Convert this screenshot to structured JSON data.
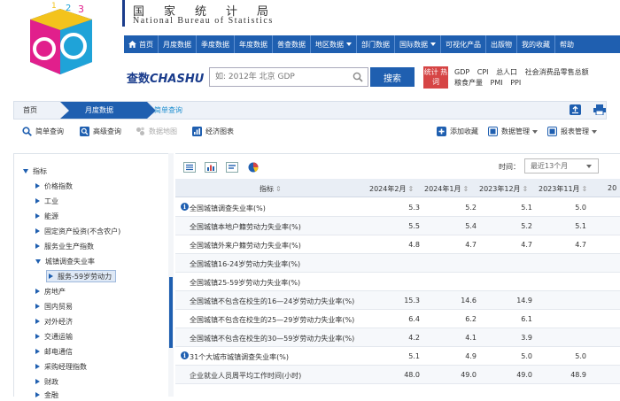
{
  "site": {
    "title_cn": "国家统计局",
    "title_en": "National Bureau of Statistics"
  },
  "nav": {
    "items": [
      {
        "label": "首页",
        "icon": "home-icon"
      },
      {
        "label": "月度数据"
      },
      {
        "label": "季度数据"
      },
      {
        "label": "年度数据"
      },
      {
        "label": "普查数据"
      },
      {
        "label": "地区数据",
        "dropdown": true
      },
      {
        "label": "部门数据"
      },
      {
        "label": "国际数据",
        "dropdown": true
      },
      {
        "label": "可视化产品"
      },
      {
        "label": "出版物"
      },
      {
        "label": "我的收藏"
      },
      {
        "label": "帮助"
      }
    ]
  },
  "search": {
    "brand_cn": "查数",
    "brand_en": "CHASHU",
    "placeholder": "如: 2012年 北京 GDP",
    "button": "搜索",
    "hot_label": "统计 热词",
    "hot_links": [
      "GDP",
      "CPI",
      "总人口",
      "社会消费品零售总额",
      "粮食产量",
      "PMI",
      "PPI"
    ]
  },
  "breadcrumb": {
    "home": "首页",
    "monthly": "月度数据",
    "current": "简单查询"
  },
  "toolbar": {
    "simple_query": "简单查询",
    "advanced_query": "高级查询",
    "data_map": "数据地图",
    "economic_chart": "经济图表",
    "add_favorite": "添加收藏",
    "data_manage": "数据管理",
    "table_manage": "报表管理"
  },
  "sidebar": {
    "root": "指标",
    "items": [
      "价格指数",
      "工业",
      "能源",
      "固定资产投资(不含农户)",
      "服务业生产指数",
      "城镇调查失业率",
      "服务-59岁劳动力",
      "房地产",
      "国内贸易",
      "对外经济",
      "交通运输",
      "邮电通信",
      "采购经理指数",
      "财政",
      "金融"
    ],
    "expanded": "城镇调查失业率",
    "selected_child": "服务-59岁劳动力"
  },
  "table": {
    "time_label": "时间：",
    "time_value": "最近13个月",
    "indicator_header": "指标",
    "columns": [
      "2024年2月",
      "2024年1月",
      "2023年12月",
      "2023年11月",
      "20"
    ],
    "rows": [
      {
        "name": "全国城镇调查失业率(%)",
        "info": true,
        "values": [
          "5.3",
          "5.2",
          "5.1",
          "5.0"
        ]
      },
      {
        "name": "全国城镇本地户籍劳动力失业率(%)",
        "info": false,
        "values": [
          "5.5",
          "5.4",
          "5.2",
          "5.1"
        ]
      },
      {
        "name": "全国城镇外来户籍劳动力失业率(%)",
        "info": false,
        "values": [
          "4.8",
          "4.7",
          "4.7",
          "4.7"
        ]
      },
      {
        "name": "全国城镇16-24岁劳动力失业率(%)",
        "info": false,
        "values": [
          "",
          "",
          "",
          ""
        ]
      },
      {
        "name": "全国城镇25-59岁劳动力失业率(%)",
        "info": false,
        "values": [
          "",
          "",
          "",
          ""
        ]
      },
      {
        "name": "全国城镇不包含在校生的16—24岁劳动力失业率(%)",
        "info": false,
        "values": [
          "15.3",
          "14.6",
          "14.9",
          ""
        ]
      },
      {
        "name": "全国城镇不包含在校生的25—29岁劳动力失业率(%)",
        "info": false,
        "values": [
          "6.4",
          "6.2",
          "6.1",
          ""
        ]
      },
      {
        "name": "全国城镇不包含在校生的30—59岁劳动力失业率(%)",
        "info": false,
        "values": [
          "4.2",
          "4.1",
          "3.9",
          ""
        ]
      },
      {
        "name": "31个大城市城镇调查失业率(%)",
        "info": true,
        "values": [
          "5.1",
          "4.9",
          "5.0",
          "5.0"
        ]
      },
      {
        "name": "企业就业人员周平均工作时间(小时)",
        "info": false,
        "values": [
          "48.0",
          "49.0",
          "49.0",
          "48.9"
        ]
      }
    ]
  },
  "colors": {
    "primary": "#1f5fb0",
    "hot_badge": "#d64545",
    "link_active": "#1f8fd0"
  }
}
